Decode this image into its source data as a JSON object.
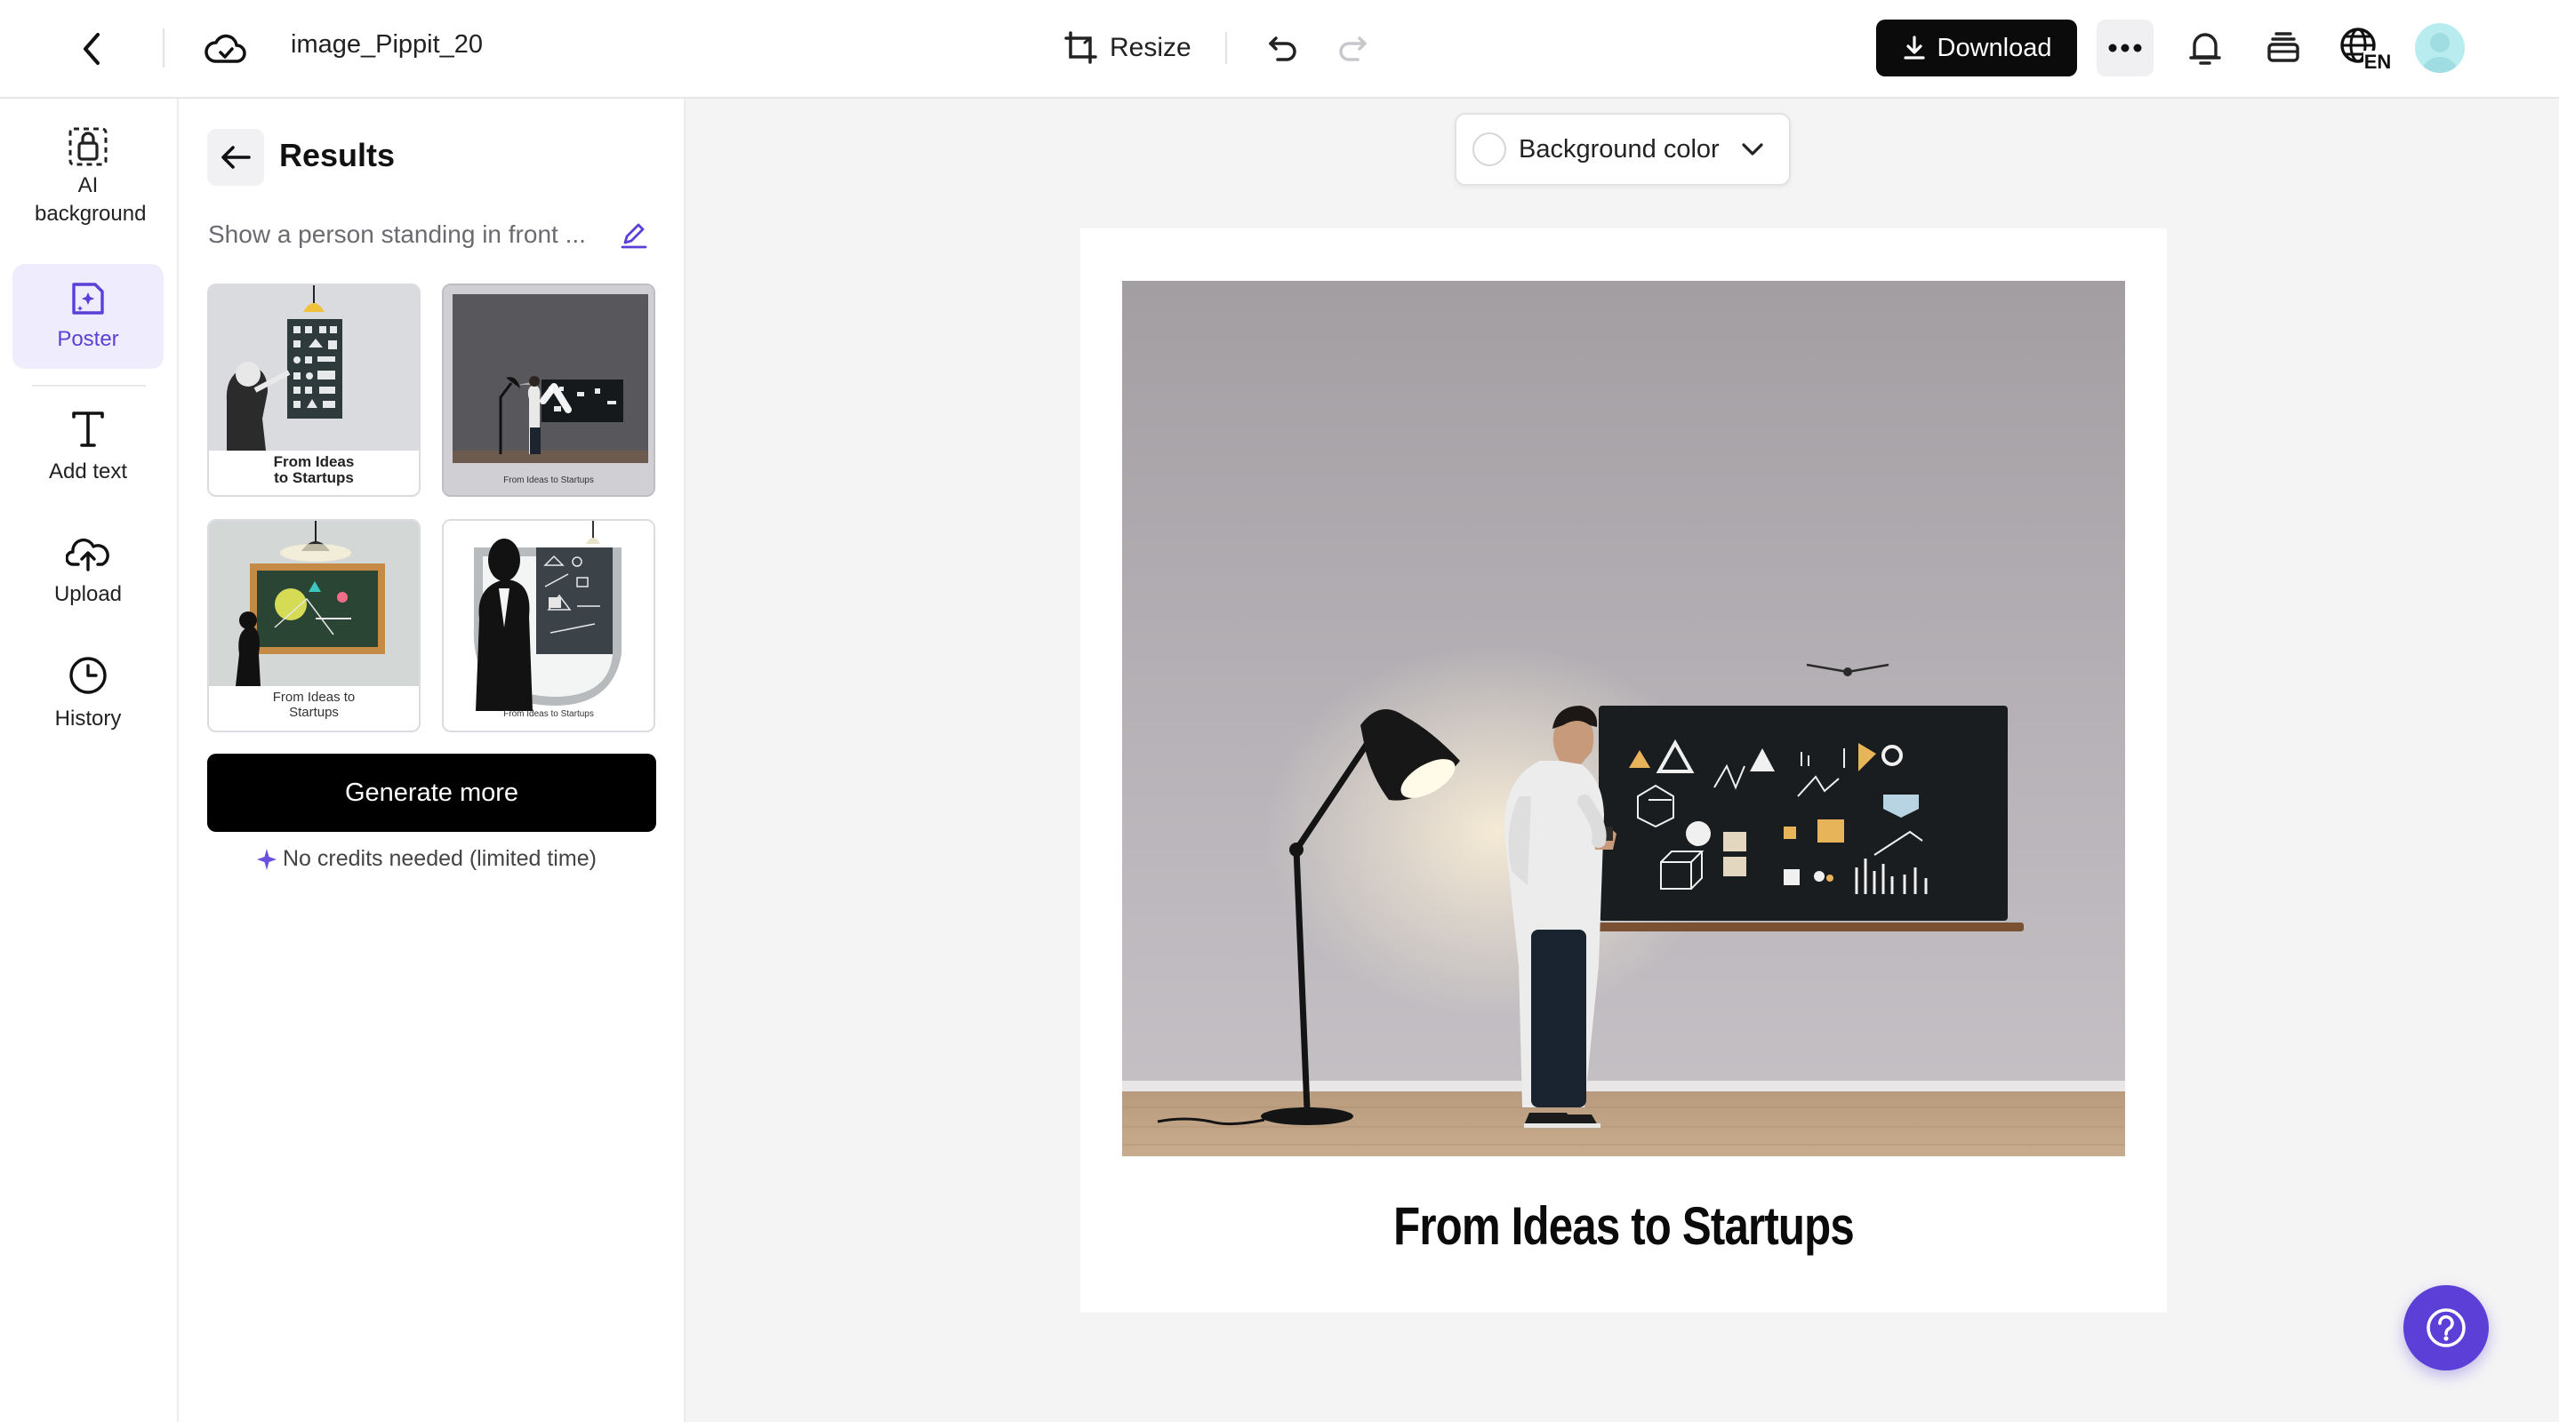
{
  "header": {
    "file_name": "image_Pippit_20",
    "resize_label": "Resize",
    "download_label": "Download",
    "language_badge": "EN",
    "icons": [
      "back-chevron-icon",
      "cloud-sync-icon",
      "resize-icon",
      "undo-icon",
      "redo-icon",
      "download-icon",
      "more-icon",
      "bell-icon",
      "layers-icon",
      "globe-language-icon",
      "avatar"
    ]
  },
  "sidebar": {
    "items": [
      {
        "label": "AI background",
        "icon": "ai-background-icon"
      },
      {
        "label": "Poster",
        "icon": "poster-icon",
        "active": true
      },
      {
        "label": "Add text",
        "icon": "text-icon"
      },
      {
        "label": "Upload",
        "icon": "upload-icon"
      },
      {
        "label": "History",
        "icon": "history-icon"
      }
    ]
  },
  "results": {
    "title": "Results",
    "prompt": "Show a person standing in front ...",
    "thumbnails": [
      {
        "caption": "From Ideas to Startups",
        "selected": false
      },
      {
        "caption": "From Ideas to Startups",
        "selected": true
      },
      {
        "caption": "From Ideas to Startups",
        "selected": false
      },
      {
        "caption": "From Ideas to Startups",
        "selected": false
      }
    ],
    "generate_label": "Generate more",
    "credits_note": "No credits needed (limited time)"
  },
  "canvas": {
    "background_color_label": "Background color",
    "poster_title": "From Ideas to Startups"
  },
  "colors": {
    "accent": "#5b3fd6",
    "accent_soft": "#efedfd",
    "primary_button": "#000000",
    "canvas_bg": "#f4f4f5"
  }
}
